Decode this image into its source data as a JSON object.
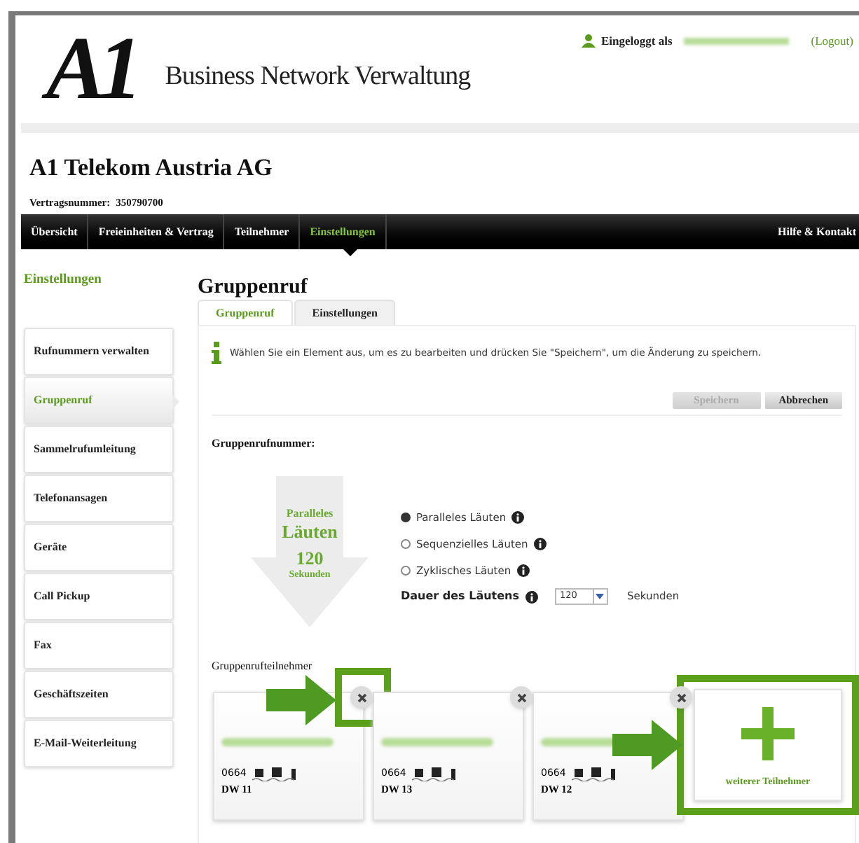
{
  "header": {
    "logo": "A1",
    "title": "Business Network Verwaltung",
    "login_label": "Eingeloggt als",
    "logout": "(Logout)"
  },
  "company": {
    "name": "A1 Telekom Austria AG",
    "contract_label": "Vertragsnummer:",
    "contract_number": "350790700"
  },
  "nav": {
    "items": [
      {
        "label": "Übersicht",
        "selected": false
      },
      {
        "label": "Freieinheiten & Vertrag",
        "selected": false
      },
      {
        "label": "Teilnehmer",
        "selected": false
      },
      {
        "label": "Einstellungen",
        "selected": true
      }
    ],
    "help": "Hilfe & Kontakt"
  },
  "sidebar": {
    "title": "Einstellungen",
    "items": [
      {
        "label": "Rufnummern verwalten",
        "selected": false
      },
      {
        "label": "Gruppenruf",
        "selected": true
      },
      {
        "label": "Sammelrufumleitung",
        "selected": false
      },
      {
        "label": "Telefonansagen",
        "selected": false
      },
      {
        "label": "Geräte",
        "selected": false
      },
      {
        "label": "Call Pickup",
        "selected": false
      },
      {
        "label": "Fax",
        "selected": false
      },
      {
        "label": "Geschäftszeiten",
        "selected": false
      },
      {
        "label": "E-Mail-Weiterleitung",
        "selected": false
      }
    ]
  },
  "page": {
    "title": "Gruppenruf",
    "tabs": [
      {
        "label": "Gruppenruf",
        "selected": true
      },
      {
        "label": "Einstellungen",
        "selected": false
      }
    ],
    "info": "Wählen Sie ein Element aus, um es zu bearbeiten und drücken Sie \"Speichern\", um die Änderung zu speichern.",
    "buttons": [
      {
        "label": "Speichern",
        "disabled": true
      },
      {
        "label": "Abbrechen",
        "disabled": false
      }
    ],
    "number_label": "Gruppenrufnummer:",
    "ring": {
      "line1": "Paralleles",
      "line2": "Läuten",
      "seconds": "120",
      "unit": "Sekunden"
    },
    "modes": [
      {
        "label": "Paralleles Läuten",
        "selected": true
      },
      {
        "label": "Sequenzielles Läuten",
        "selected": false
      },
      {
        "label": "Zyklisches Läuten",
        "selected": false
      }
    ],
    "duration": {
      "label": "Dauer des Läutens",
      "value": "120",
      "unit": "Sekunden"
    },
    "members_label": "Gruppenrufteilnehmer",
    "members": [
      {
        "number": "0664",
        "extension": "DW 11",
        "highlighted": true
      },
      {
        "number": "0664",
        "extension": "DW 13",
        "highlighted": false
      },
      {
        "number": "0664",
        "extension": "DW 12",
        "highlighted": false
      }
    ],
    "add": {
      "label": "weiterer Teilnehmer",
      "highlighted": true
    }
  }
}
